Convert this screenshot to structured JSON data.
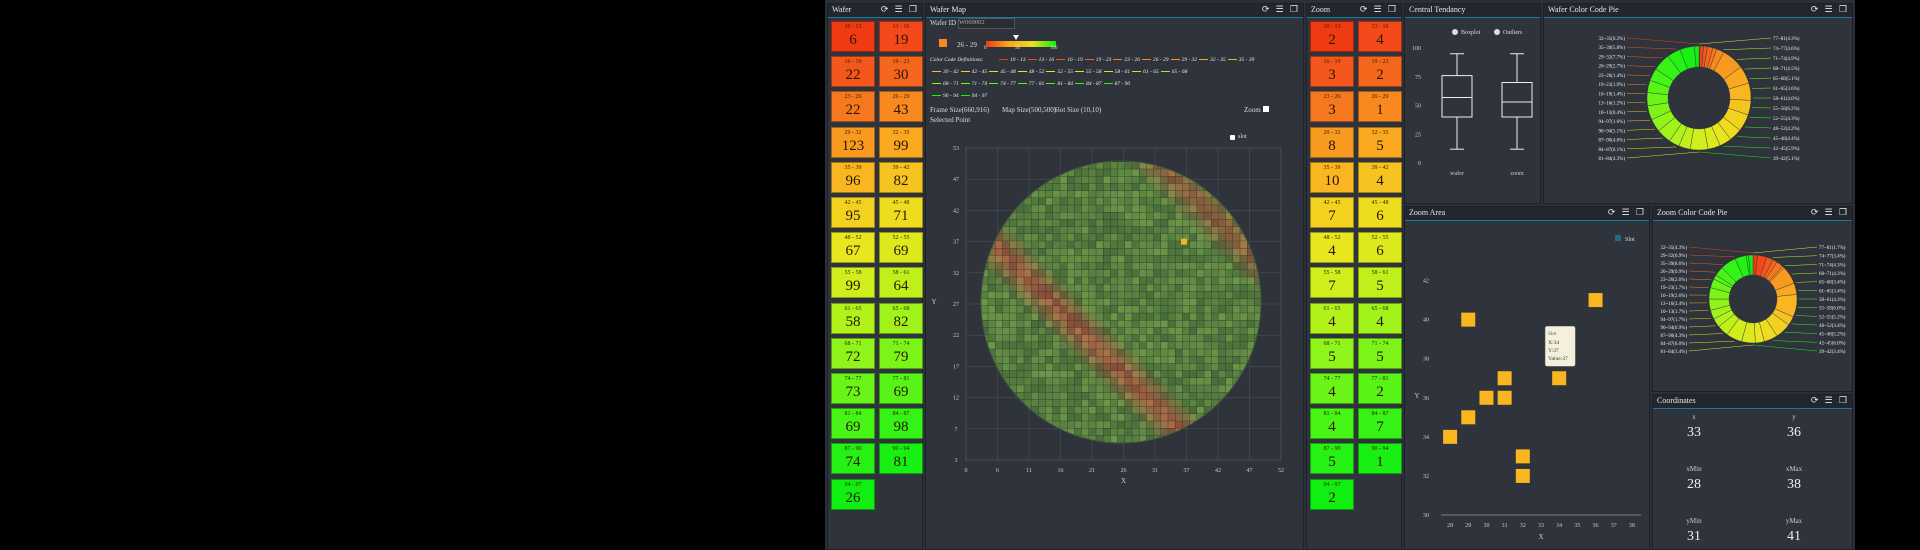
{
  "panels": {
    "wafer": {
      "title": "Wafer"
    },
    "wafer_map": {
      "title": "Wafer Map"
    },
    "zoom": {
      "title": "Zoom"
    },
    "central": {
      "title": "Central Tendancy"
    },
    "wafer_pie": {
      "title": "Wafer Color Code Pie"
    },
    "zoom_area": {
      "title": "Zoom Area"
    },
    "zoom_pie": {
      "title": "Zoom Color Code Pie"
    },
    "coordinates": {
      "title": "Coordinates"
    }
  },
  "icons_text": "⟳ ☰ ❐",
  "wafer_tiles": [
    {
      "range": "10 - 13",
      "count": "6"
    },
    {
      "range": "13 - 16",
      "count": "19"
    },
    {
      "range": "16 - 19",
      "count": "22"
    },
    {
      "range": "19 - 23",
      "count": "30"
    },
    {
      "range": "23 - 26",
      "count": "22"
    },
    {
      "range": "26 - 29",
      "count": "43"
    },
    {
      "range": "29 - 32",
      "count": "123"
    },
    {
      "range": "32 - 35",
      "count": "99"
    },
    {
      "range": "35 - 39",
      "count": "96"
    },
    {
      "range": "39 - 42",
      "count": "82"
    },
    {
      "range": "42 - 45",
      "count": "95"
    },
    {
      "range": "45 - 48",
      "count": "71"
    },
    {
      "range": "48 - 52",
      "count": "67"
    },
    {
      "range": "52 - 55",
      "count": "69"
    },
    {
      "range": "55 - 58",
      "count": "99"
    },
    {
      "range": "58 - 61",
      "count": "64"
    },
    {
      "range": "61 - 65",
      "count": "58"
    },
    {
      "range": "65 - 68",
      "count": "82"
    },
    {
      "range": "68 - 71",
      "count": "72"
    },
    {
      "range": "71 - 74",
      "count": "79"
    },
    {
      "range": "74 - 77",
      "count": "73"
    },
    {
      "range": "77 - 81",
      "count": "69"
    },
    {
      "range": "81 - 84",
      "count": "69"
    },
    {
      "range": "84 - 87",
      "count": "98"
    },
    {
      "range": "87 - 90",
      "count": "74"
    },
    {
      "range": "90 - 94",
      "count": "81"
    },
    {
      "range": "94 - 97",
      "count": "26"
    }
  ],
  "zoom_tiles": [
    {
      "range": "10 - 13",
      "count": "2"
    },
    {
      "range": "13 - 16",
      "count": "4"
    },
    {
      "range": "16 - 19",
      "count": "3"
    },
    {
      "range": "19 - 23",
      "count": "2"
    },
    {
      "range": "23 - 26",
      "count": "3"
    },
    {
      "range": "26 - 29",
      "count": "1"
    },
    {
      "range": "29 - 32",
      "count": "8"
    },
    {
      "range": "32 - 35",
      "count": "5"
    },
    {
      "range": "35 - 39",
      "count": "10"
    },
    {
      "range": "39 - 42",
      "count": "4"
    },
    {
      "range": "42 - 45",
      "count": "7"
    },
    {
      "range": "45 - 48",
      "count": "6"
    },
    {
      "range": "48 - 52",
      "count": "4"
    },
    {
      "range": "52 - 55",
      "count": "6"
    },
    {
      "range": "55 - 58",
      "count": "7"
    },
    {
      "range": "58 - 61",
      "count": "5"
    },
    {
      "range": "61 - 65",
      "count": "4"
    },
    {
      "range": "65 - 68",
      "count": "4"
    },
    {
      "range": "68 - 71",
      "count": "5"
    },
    {
      "range": "71 - 74",
      "count": "5"
    },
    {
      "range": "74 - 77",
      "count": "4"
    },
    {
      "range": "77 - 81",
      "count": "2"
    },
    {
      "range": "81 - 84",
      "count": "4"
    },
    {
      "range": "84 - 87",
      "count": "7"
    },
    {
      "range": "87 - 90",
      "count": "5"
    },
    {
      "range": "90 - 94",
      "count": "1"
    },
    {
      "range": "94 - 97",
      "count": "2"
    }
  ],
  "tile_colors": [
    "#f03a12",
    "#f2481a",
    "#f4571c",
    "#f5661d",
    "#f6781e",
    "#f7891f",
    "#f89a1f",
    "#f9a820",
    "#f9b620",
    "#f6c420",
    "#f3d21f",
    "#eedd1e",
    "#e8e61e",
    "#dcea1d",
    "#cfee1c",
    "#c0f01b",
    "#b0f21a",
    "#a0f31a",
    "#8ef419",
    "#7cf418",
    "#6af418",
    "#58f417",
    "#46f416",
    "#35f315",
    "#25f214",
    "#18f013",
    "#10ee12"
  ],
  "wafer_map": {
    "wafer_id_label": "Wafer ID",
    "wafer_id_value": "W000002",
    "selected_range": "26 - 29",
    "scale_min": "0",
    "scale_mid": "50",
    "scale_max": "100",
    "legend_title": "Color Code Definitions:",
    "legend_ranges": [
      "10 - 13",
      "13 - 16",
      "16 - 19",
      "19 - 23",
      "23 - 26",
      "26 - 29",
      "29 - 32",
      "32 - 35",
      "35 - 39",
      "39 - 42",
      "42 - 45",
      "45 - 48",
      "48 - 52",
      "52 - 55",
      "55 - 58",
      "58 - 61",
      "61 - 65",
      "65 - 68",
      "68 - 71",
      "71 - 74",
      "74 - 77",
      "77 - 81",
      "81 - 84",
      "84 - 87",
      "87 - 90",
      "90 - 94",
      "94 - 97"
    ],
    "frame_size": "Frame Size(660,916)",
    "map_size": "Map Size(500,500)",
    "slot_size": "Slot Size (10,10)",
    "zoom_label": "Zoom",
    "selected_point": "Selected Point",
    "slot_legend": "slot",
    "x_label": "X",
    "y_label": "Y",
    "x_ticks": [
      "0",
      "6",
      "11",
      "16",
      "21",
      "26",
      "31",
      "37",
      "42",
      "47",
      "52"
    ],
    "y_ticks": [
      "3",
      "7",
      "12",
      "17",
      "22",
      "27",
      "32",
      "37",
      "42",
      "47",
      "53"
    ]
  },
  "central": {
    "legend_boxplot": "Boxplot",
    "legend_outliers": "Outliers",
    "y_ticks": [
      "0",
      "25",
      "50",
      "75",
      "100"
    ],
    "categories": [
      "wafer",
      "zoom"
    ]
  },
  "wafer_pie": {
    "labels": [
      "32~35(6.2%)",
      "35~39(5.8%)",
      "29~32(7.7%)",
      "26~29(2.7%)",
      "23~26(1.4%)",
      "19~23(1.9%)",
      "16~19(1.4%)",
      "13~16(1.2%)",
      "10~13(0.4%)",
      "94~97(1.6%)",
      "90~94(5.1%)",
      "87~90(4.6%)",
      "84~87(6.1%)",
      "81~84(4.3%)",
      "77~81(4.3%)",
      "74~77(4.6%)",
      "71~74(4.9%)",
      "68~71(4.5%)",
      "65~68(5.1%)",
      "61~65(3.6%)",
      "58~61(4.0%)",
      "55~58(6.2%)",
      "52~55(4.3%)",
      "48~52(4.2%)",
      "45~48(4.4%)",
      "42~45(5.9%)",
      "39~42(5.1%)"
    ]
  },
  "zoom_pie": {
    "labels": [
      "32~35(4.3%)",
      "29~32(6.9%)",
      "35~39(8.6%)",
      "26~29(0.9%)",
      "23~26(2.6%)",
      "19~23(1.7%)",
      "16~19(2.6%)",
      "13~16(3.4%)",
      "10~13(1.7%)",
      "94~97(1.7%)",
      "90~94(0.9%)",
      "87~90(4.3%)",
      "84~87(6.0%)",
      "81~84(3.4%)",
      "77~81(1.7%)",
      "74~77(3.4%)",
      "71~74(4.3%)",
      "68~71(4.3%)",
      "65~68(3.4%)",
      "61~65(3.4%)",
      "58~61(4.3%)",
      "55~58(6.0%)",
      "52~55(5.2%)",
      "48~52(3.4%)",
      "45~48(5.2%)",
      "42~45(6.0%)",
      "39~42(3.4%)"
    ]
  },
  "zoom_area": {
    "legend": "Slot",
    "x_label": "X",
    "y_label": "Y",
    "x_ticks": [
      "28",
      "29",
      "30",
      "31",
      "32",
      "33",
      "34",
      "35",
      "36",
      "37",
      "38"
    ],
    "y_ticks": [
      "30",
      "32",
      "34",
      "36",
      "38",
      "40",
      "42"
    ],
    "tooltip_title": "Slot",
    "tooltip_x": "X:34",
    "tooltip_y": "Y:37",
    "tooltip_value": "Value:37"
  },
  "coordinates": {
    "x_label": "x",
    "x_value": "33",
    "y_label": "y",
    "y_value": "36",
    "xmin_label": "xMin",
    "xmin_value": "28",
    "xmax_label": "xMax",
    "xmax_value": "38",
    "ymin_label": "yMin",
    "ymin_value": "31",
    "ymax_label": "yMax",
    "ymax_value": "41"
  },
  "chart_data": [
    {
      "type": "heatmap",
      "title": "Wafer Map",
      "xlabel": "X",
      "ylabel": "Y",
      "xlim": [
        0,
        52
      ],
      "ylim": [
        3,
        53
      ],
      "selected_point": {
        "x": 36,
        "y": 38
      }
    },
    {
      "type": "box",
      "title": "Central Tendancy",
      "categories": [
        "wafer",
        "zoom"
      ],
      "ylim": [
        0,
        100
      ],
      "series": [
        {
          "name": "wafer",
          "min": 12,
          "q1": 40,
          "median": 57,
          "q3": 76,
          "max": 95
        },
        {
          "name": "zoom",
          "min": 12,
          "q1": 40,
          "median": 53,
          "q3": 70,
          "max": 95
        }
      ]
    },
    {
      "type": "pie",
      "title": "Wafer Color Code Pie",
      "categories": [
        "10~13",
        "13~16",
        "16~19",
        "19~23",
        "23~26",
        "26~29",
        "29~32",
        "32~35",
        "35~39",
        "39~42",
        "42~45",
        "45~48",
        "48~52",
        "52~55",
        "55~58",
        "58~61",
        "61~65",
        "65~68",
        "68~71",
        "71~74",
        "74~77",
        "77~81",
        "81~84",
        "84~87",
        "87~90",
        "90~94",
        "94~97"
      ],
      "values": [
        6,
        19,
        22,
        30,
        22,
        43,
        123,
        99,
        96,
        82,
        95,
        71,
        67,
        69,
        99,
        64,
        58,
        82,
        72,
        79,
        73,
        69,
        69,
        98,
        74,
        81,
        26
      ]
    },
    {
      "type": "scatter",
      "title": "Zoom Area",
      "xlabel": "X",
      "ylabel": "Y",
      "xlim": [
        27.5,
        38.5
      ],
      "ylim": [
        30,
        43
      ],
      "series": [
        {
          "name": "Slot",
          "points": [
            [
              28,
              34
            ],
            [
              29,
              35
            ],
            [
              29,
              40
            ],
            [
              30,
              36
            ],
            [
              31,
              36
            ],
            [
              31,
              37
            ],
            [
              32,
              33
            ],
            [
              32,
              32
            ],
            [
              34,
              37
            ],
            [
              36,
              41
            ]
          ]
        }
      ]
    },
    {
      "type": "pie",
      "title": "Zoom Color Code Pie",
      "categories": [
        "10~13",
        "13~16",
        "16~19",
        "19~23",
        "23~26",
        "26~29",
        "29~32",
        "32~35",
        "35~39",
        "39~42",
        "42~45",
        "45~48",
        "48~52",
        "52~55",
        "55~58",
        "58~61",
        "61~65",
        "65~68",
        "68~71",
        "71~74",
        "74~77",
        "77~81",
        "81~84",
        "84~87",
        "87~90",
        "90~94",
        "94~97"
      ],
      "values": [
        2,
        4,
        3,
        2,
        3,
        1,
        8,
        5,
        10,
        4,
        7,
        6,
        4,
        6,
        7,
        5,
        4,
        4,
        5,
        5,
        4,
        2,
        4,
        7,
        5,
        1,
        2
      ]
    }
  ]
}
